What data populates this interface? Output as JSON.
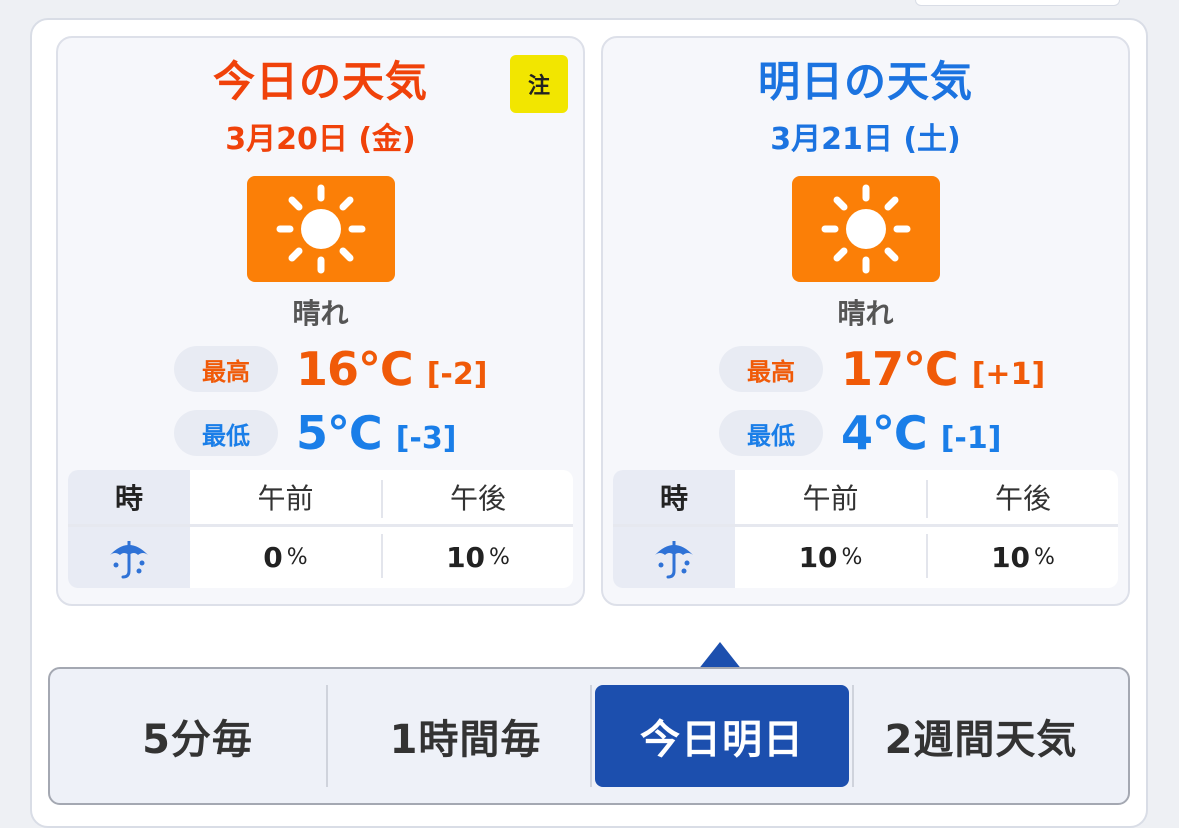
{
  "today": {
    "title": "今日の天気",
    "date": "3月20日 (金)",
    "warning_badge": "注",
    "condition": "晴れ",
    "condition_icon": "sun-icon",
    "high_label": "最高",
    "high_value": "16℃",
    "high_diff": "[-2]",
    "low_label": "最低",
    "low_value": "5℃",
    "low_diff": "[-3]",
    "precip": {
      "header_label": "時",
      "columns": [
        "午前",
        "午後"
      ],
      "row_icon": "umbrella-icon",
      "values": [
        "0",
        "10"
      ],
      "unit": "%"
    }
  },
  "tomorrow": {
    "title": "明日の天気",
    "date": "3月21日 (土)",
    "condition": "晴れ",
    "condition_icon": "sun-icon",
    "high_label": "最高",
    "high_value": "17℃",
    "high_diff": "[+1]",
    "low_label": "最低",
    "low_value": "4℃",
    "low_diff": "[-1]",
    "precip": {
      "header_label": "時",
      "columns": [
        "午前",
        "午後"
      ],
      "row_icon": "umbrella-icon",
      "values": [
        "10",
        "10"
      ],
      "unit": "%"
    }
  },
  "tabs": [
    {
      "label": "5分毎",
      "active": false
    },
    {
      "label": "1時間毎",
      "active": false
    },
    {
      "label": "今日明日",
      "active": true
    },
    {
      "label": "2週間天気",
      "active": false
    }
  ],
  "colors": {
    "today_accent": "#f0420a",
    "tomorrow_accent": "#1b73e0",
    "high_temp": "#f05a08",
    "low_temp": "#1a7ee8",
    "sunny_tile": "#fb7f07",
    "warning_yellow": "#f2e600",
    "active_tab": "#1c4fae"
  }
}
